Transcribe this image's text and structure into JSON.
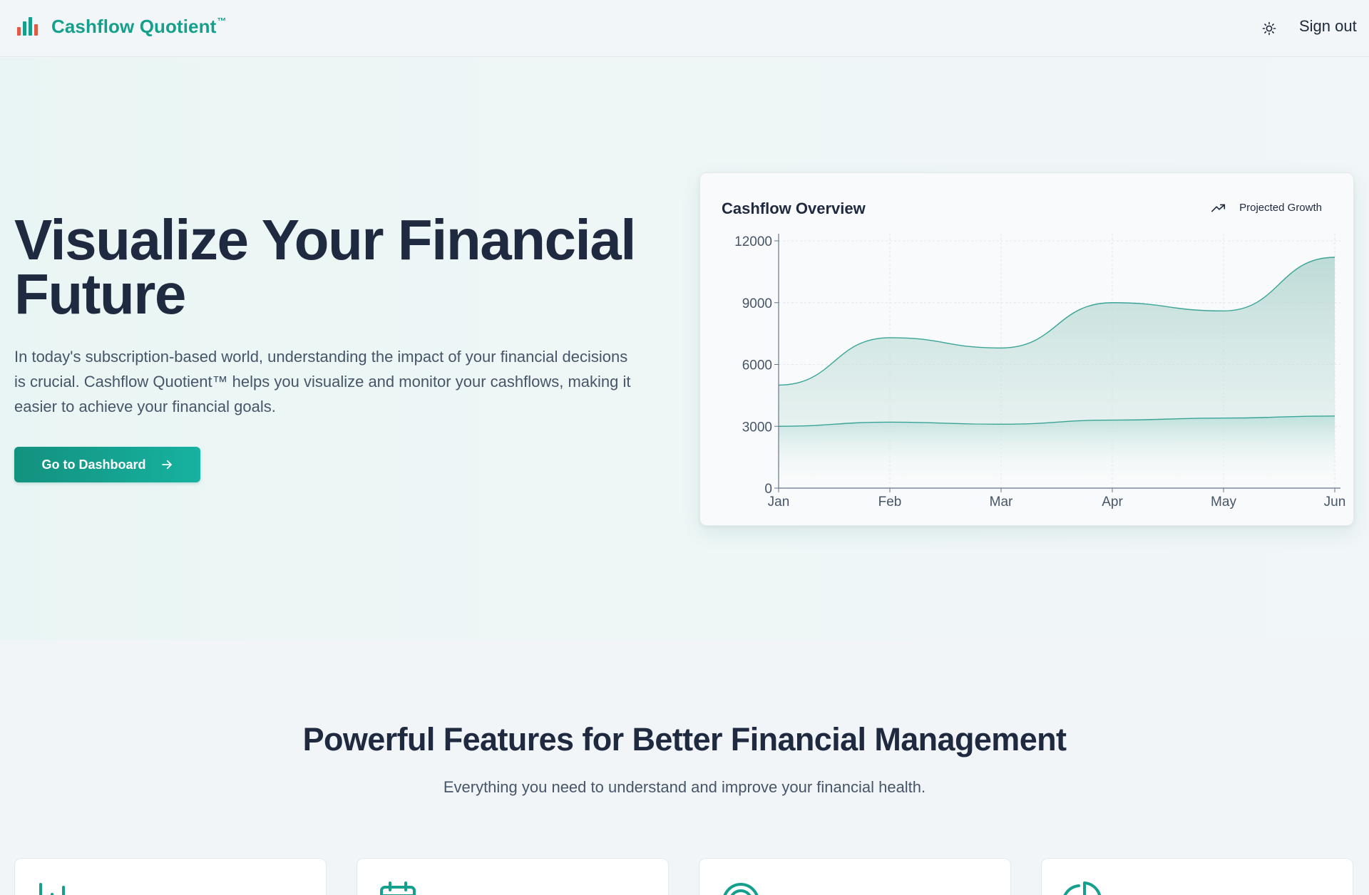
{
  "header": {
    "brand_name": "Cashflow Quotient",
    "brand_mark": "™",
    "signout_label": "Sign out",
    "icons": {
      "logo": "bar-chart-logo-icon",
      "theme": "sun-icon"
    }
  },
  "hero": {
    "title": "Visualize Your Financial Future",
    "description": "In today's subscription-based world, understanding the impact of your financial decisions is crucial. Cashflow Quotient™ helps you visualize and monitor your cashflows, making it easier to achieve your financial goals.",
    "cta_label": "Go to Dashboard"
  },
  "chart_card": {
    "title": "Cashflow Overview",
    "legend_label": "Projected Growth"
  },
  "chart_data": {
    "type": "area",
    "title": "Cashflow Overview",
    "categories": [
      "Jan",
      "Feb",
      "Mar",
      "Apr",
      "May",
      "Jun"
    ],
    "series": [
      {
        "name": "Projected Growth",
        "values": [
          5000,
          7300,
          6800,
          9000,
          8600,
          11200
        ]
      },
      {
        "values": [
          3000,
          3200,
          3100,
          3300,
          3400,
          3500
        ]
      }
    ],
    "y_ticks": [
      0,
      3000,
      6000,
      9000,
      12000
    ],
    "ylim": [
      0,
      12000
    ],
    "grid": true,
    "legend_position": "top-right",
    "colors": {
      "line": "#3aa597",
      "fill": "#b7d9d4",
      "axis": "#64748b"
    }
  },
  "features": {
    "title": "Powerful Features for Better Financial Management",
    "subtitle": "Everything you need to understand and improve your financial health.",
    "cards": [
      {
        "icon": "bar-chart-icon"
      },
      {
        "icon": "calendar-icon"
      },
      {
        "icon": "target-icon"
      },
      {
        "icon": "pie-chart-icon"
      }
    ]
  },
  "colors": {
    "brand": "#14a08c",
    "heading": "#1f2a40",
    "body_text": "#475569",
    "logo_bars": [
      "#e05a47",
      "#14a08c",
      "#14a08c",
      "#e05a47"
    ]
  }
}
